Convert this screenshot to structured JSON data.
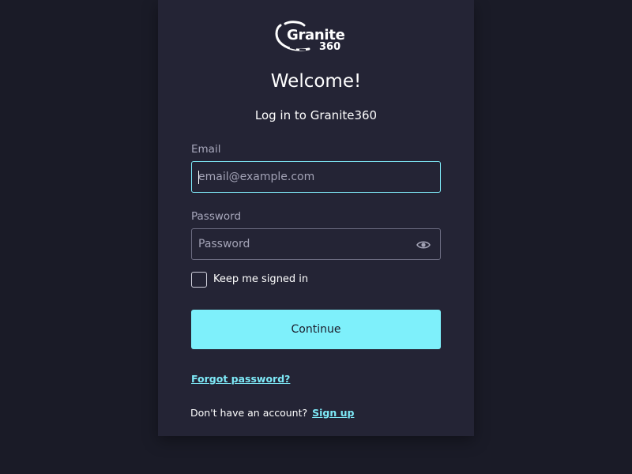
{
  "logo": {
    "name": "Granite",
    "sub": "360"
  },
  "heading": "Welcome!",
  "subtitle": "Log in to Granite360",
  "email": {
    "label": "Email",
    "placeholder": "email@example.com",
    "value": ""
  },
  "password": {
    "label": "Password",
    "placeholder": "Password",
    "value": "",
    "toggle_icon": "eye-icon"
  },
  "remember": {
    "label": "Keep me signed in",
    "checked": false
  },
  "continue_label": "Continue",
  "forgot_label": "Forgot password?",
  "signup": {
    "prompt": "Don't have an account?",
    "link": "Sign up"
  },
  "colors": {
    "background": "#1a1b27",
    "card": "#242435",
    "accent": "#7ef0fb",
    "text": "#ffffff",
    "muted": "#a8a8bc"
  }
}
